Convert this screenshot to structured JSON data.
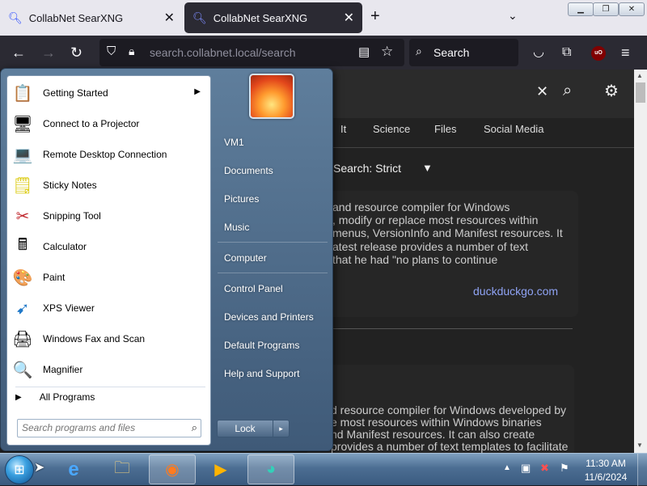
{
  "browser": {
    "tabs": [
      {
        "label": "CollabNet SearXNG"
      },
      {
        "label": "CollabNet SearXNG"
      }
    ],
    "new_tab_icon": "+",
    "list_tabs_icon": "⌄",
    "window_buttons": {
      "minimize": "▁",
      "maximize": "❐",
      "close": "✕"
    },
    "url": "search.collabnet.local/search",
    "search_placeholder": "Search",
    "ublock_label": "uO"
  },
  "page": {
    "categories": [
      "It",
      "Science",
      "Files",
      "Social Media"
    ],
    "safe_search": "Search: Strict",
    "result1": {
      "lines": [
        "and resource compiler for Windows",
        ", modify or replace most resources within",
        "menus, VersionInfo and Manifest resources. It",
        "atest release provides a number of text",
        "that he had \"no plans to continue"
      ],
      "source": "duckduckgo.com"
    },
    "result2": {
      "lines": [
        "d resource compiler for Windows developed by",
        "e most resources within Windows binaries",
        "nd Manifest resources. It can also create",
        "provides a number of text templates to facilitate"
      ]
    }
  },
  "start_menu": {
    "programs": [
      {
        "label": "Getting Started",
        "icon": "getting-started-icon",
        "glyph": "📋",
        "has_submenu": true
      },
      {
        "label": "Connect to a Projector",
        "icon": "projector-icon",
        "glyph": "🖥"
      },
      {
        "label": "Remote Desktop Connection",
        "icon": "remote-desktop-icon",
        "glyph": "💻"
      },
      {
        "label": "Sticky Notes",
        "icon": "sticky-notes-icon",
        "glyph": "🗒"
      },
      {
        "label": "Snipping Tool",
        "icon": "snipping-tool-icon",
        "glyph": "✂"
      },
      {
        "label": "Calculator",
        "icon": "calculator-icon",
        "glyph": "🖩"
      },
      {
        "label": "Paint",
        "icon": "paint-icon",
        "glyph": "🎨"
      },
      {
        "label": "XPS Viewer",
        "icon": "xps-viewer-icon",
        "glyph": "➹"
      },
      {
        "label": "Windows Fax and Scan",
        "icon": "fax-scan-icon",
        "glyph": "🖨"
      },
      {
        "label": "Magnifier",
        "icon": "magnifier-icon",
        "glyph": "🔍"
      }
    ],
    "all_programs": "All Programs",
    "search_placeholder": "Search programs and files",
    "right_links": [
      "VM1",
      "Documents",
      "Pictures",
      "Music",
      "Computer",
      "Control Panel",
      "Devices and Printers",
      "Default Programs",
      "Help and Support"
    ],
    "lock_label": "Lock",
    "lock_arrow": "▸"
  },
  "taskbar": {
    "clock_time": "11:30 AM",
    "clock_date": "11/6/2024"
  },
  "colors": {
    "browser_bg": "#1c1b22",
    "toolbar_bg": "#2b2a33",
    "link_color": "#8fa3f4",
    "start_menu_bg": "#4f6b8a",
    "taskbar_bg": "#4c6e93"
  }
}
